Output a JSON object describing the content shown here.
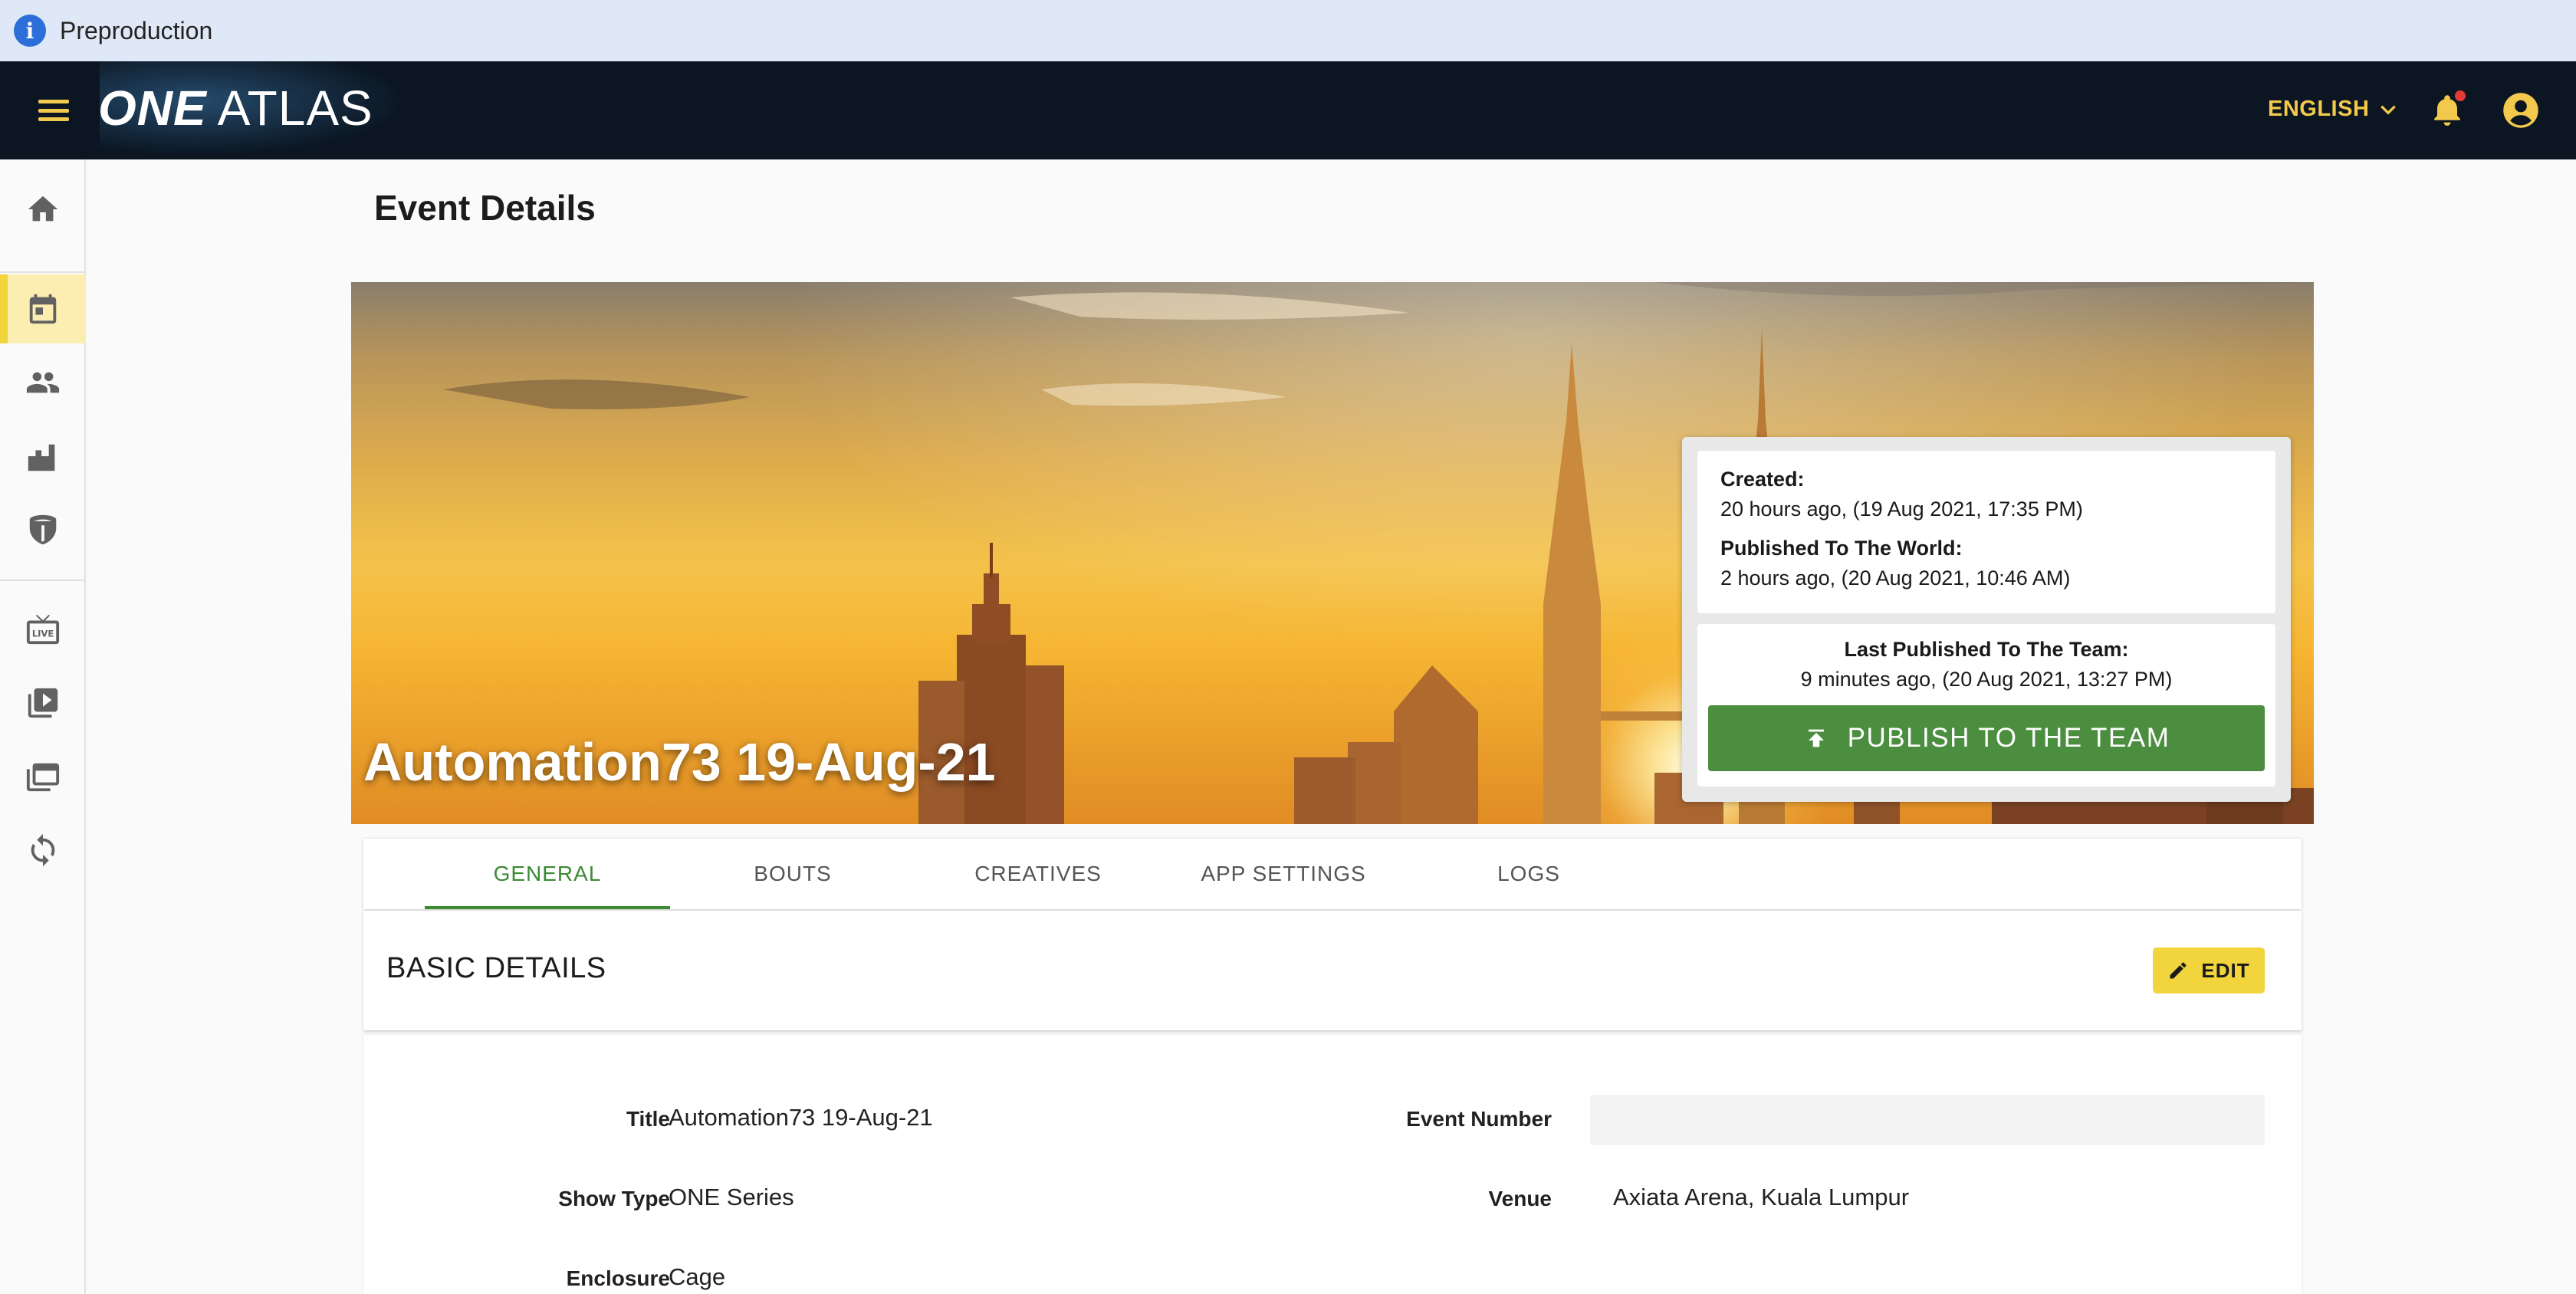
{
  "environment": {
    "label": "Preproduction"
  },
  "header": {
    "logo_primary": "ONE",
    "logo_secondary": "ATLAS",
    "language": "ENGLISH",
    "colors": {
      "bar": "#0b1622",
      "accent": "#f2c94c",
      "notification_dot": "#e53935"
    }
  },
  "sidebar": {
    "items": [
      {
        "name": "home",
        "icon": "home-icon"
      },
      {
        "name": "events",
        "icon": "calendar-icon",
        "active": true
      },
      {
        "name": "athletes",
        "icon": "people-icon"
      },
      {
        "name": "venues",
        "icon": "buildings-icon"
      },
      {
        "name": "teams",
        "icon": "shield-icon"
      },
      {
        "name": "live",
        "icon": "live-tv-icon"
      },
      {
        "name": "videos",
        "icon": "video-library-icon"
      },
      {
        "name": "collections",
        "icon": "gallery-icon"
      },
      {
        "name": "sync",
        "icon": "sync-icon"
      }
    ]
  },
  "page": {
    "title": "Event Details"
  },
  "event": {
    "title": "Automation73 19-Aug-21",
    "created_label": "Created:",
    "created_value": "20 hours ago, (19 Aug 2021, 17:35 PM)",
    "published_world_label": "Published To The World:",
    "published_world_value": "2 hours ago, (20 Aug 2021, 10:46 AM)",
    "published_team_label": "Last Published To The Team:",
    "published_team_value": "9 minutes ago, (20 Aug 2021, 13:27 PM)",
    "publish_button": "PUBLISH TO THE TEAM",
    "publish_color": "#4b8e3f"
  },
  "tabs": [
    {
      "label": "GENERAL",
      "active": true
    },
    {
      "label": "BOUTS"
    },
    {
      "label": "CREATIVES"
    },
    {
      "label": "APP SETTINGS"
    },
    {
      "label": "LOGS"
    }
  ],
  "basic_details": {
    "heading": "BASIC DETAILS",
    "edit_label": "EDIT",
    "fields": {
      "title_label": "Title",
      "title_value": "Automation73 19-Aug-21",
      "event_number_label": "Event Number",
      "event_number_value": "",
      "show_type_label": "Show Type",
      "show_type_value": "ONE Series",
      "venue_label": "Venue",
      "venue_value": "Axiata Arena, Kuala Lumpur",
      "enclosure_label": "Enclosure",
      "enclosure_value": "Cage"
    }
  }
}
